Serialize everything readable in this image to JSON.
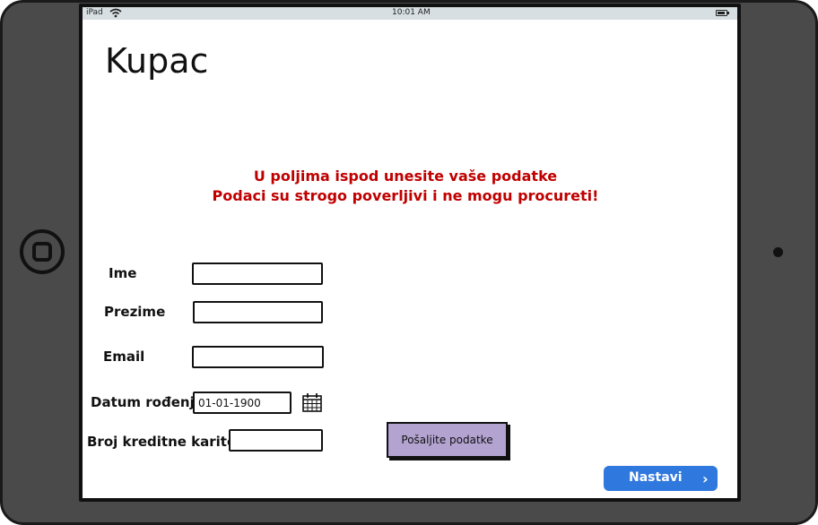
{
  "status_bar": {
    "carrier": "iPad",
    "time": "10:01 AM"
  },
  "page": {
    "title": "Kupac",
    "notice_line1": "U poljima ispod unesite vaše podatke",
    "notice_line2": "Podaci su strogo poverljivi i ne mogu procureti!"
  },
  "form": {
    "first_name_label": "Ime",
    "first_name_value": "",
    "last_name_label": "Prezime",
    "last_name_value": "",
    "email_label": "Email",
    "email_value": "",
    "birthdate_label": "Datum rođenja",
    "birthdate_value": "01-01-1900",
    "card_label": "Broj kreditne karitce",
    "card_value": ""
  },
  "buttons": {
    "submit_label": "Pošaljite podatke",
    "next_label": "Nastavi",
    "next_chevron": "›"
  },
  "colors": {
    "notice": "#c00000",
    "submit_bg": "#b3a3d1",
    "next_bg": "#2f78de",
    "status_bar_bg": "#d7dfe2"
  },
  "icons": {
    "wifi": "wifi-icon",
    "battery": "battery-icon",
    "calendar": "calendar-icon",
    "chevron": "chevron-right-icon",
    "home": "home-button-icon"
  }
}
